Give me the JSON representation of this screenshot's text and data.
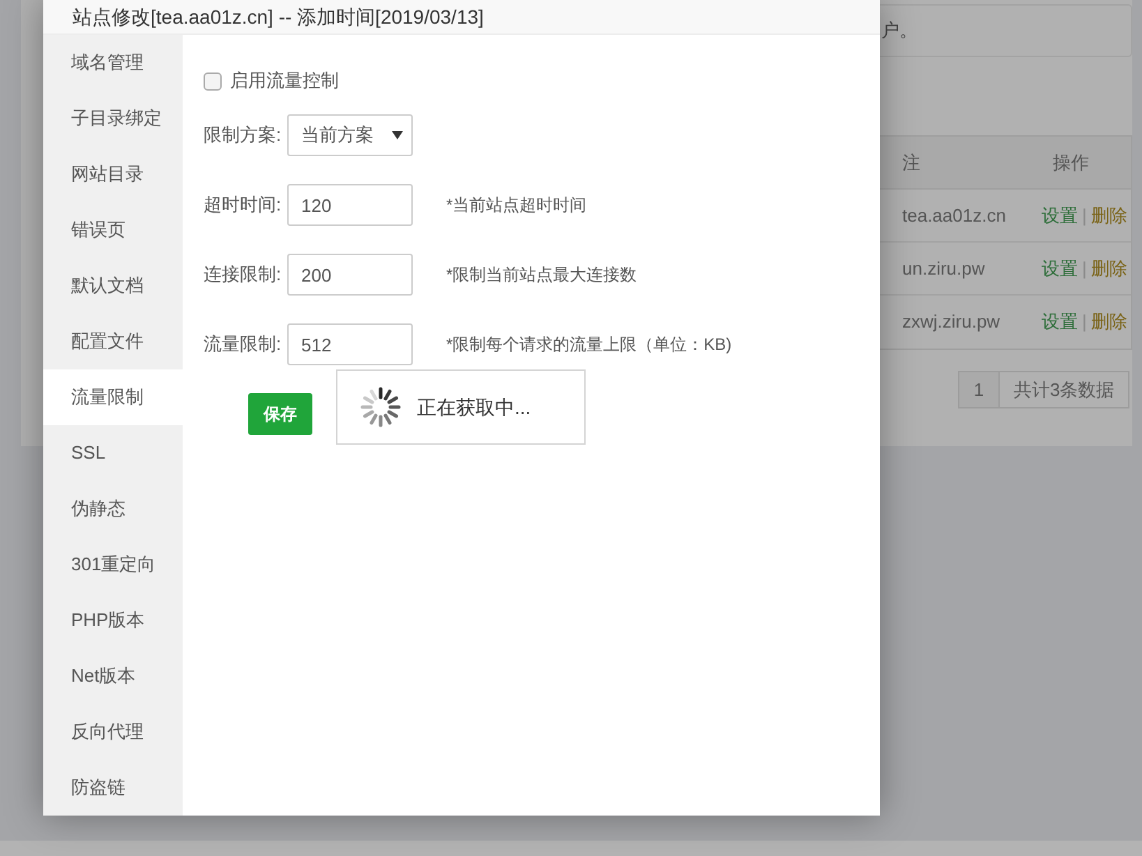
{
  "background": {
    "notice_text": "户。",
    "table": {
      "columns": [
        "注",
        "操作"
      ],
      "rows": [
        {
          "remark": "tea.aa01z.cn",
          "actions": [
            "设置",
            "删除"
          ],
          "separator": "|"
        },
        {
          "remark": "un.ziru.pw",
          "actions": [
            "设置",
            "删除"
          ],
          "separator": "|"
        },
        {
          "remark": "zxwj.ziru.pw",
          "actions": [
            "设置",
            "删除"
          ],
          "separator": "|"
        }
      ]
    },
    "pagination": {
      "page": "1",
      "total": "共计3条数据"
    }
  },
  "dialog": {
    "title": "站点修改[tea.aa01z.cn] -- 添加时间[2019/03/13]",
    "nav": [
      {
        "label": "域名管理",
        "selected": false
      },
      {
        "label": "子目录绑定",
        "selected": false
      },
      {
        "label": "网站目录",
        "selected": false
      },
      {
        "label": "错误页",
        "selected": false
      },
      {
        "label": "默认文档",
        "selected": false
      },
      {
        "label": "配置文件",
        "selected": false
      },
      {
        "label": "流量限制",
        "selected": true
      },
      {
        "label": "SSL",
        "selected": false
      },
      {
        "label": "伪静态",
        "selected": false
      },
      {
        "label": "301重定向",
        "selected": false
      },
      {
        "label": "PHP版本",
        "selected": false
      },
      {
        "label": "Net版本",
        "selected": false
      },
      {
        "label": "反向代理",
        "selected": false
      },
      {
        "label": "防盗链",
        "selected": false
      }
    ],
    "form": {
      "enable": {
        "label": "启用流量控制",
        "checked": false
      },
      "fields": [
        {
          "kind": "select",
          "label": "限制方案:",
          "value": "当前方案"
        },
        {
          "kind": "input",
          "label": "超时时间:",
          "value": "120",
          "hint": "*当前站点超时时间"
        },
        {
          "kind": "input",
          "label": "连接限制:",
          "value": "200",
          "hint": "*限制当前站点最大连接数"
        },
        {
          "kind": "input",
          "label": "流量限制:",
          "value": "512",
          "hint": "*限制每个请求的流量上限（单位：KB)"
        }
      ],
      "save_button": "保存"
    },
    "loading": {
      "text": "正在获取中..."
    }
  }
}
